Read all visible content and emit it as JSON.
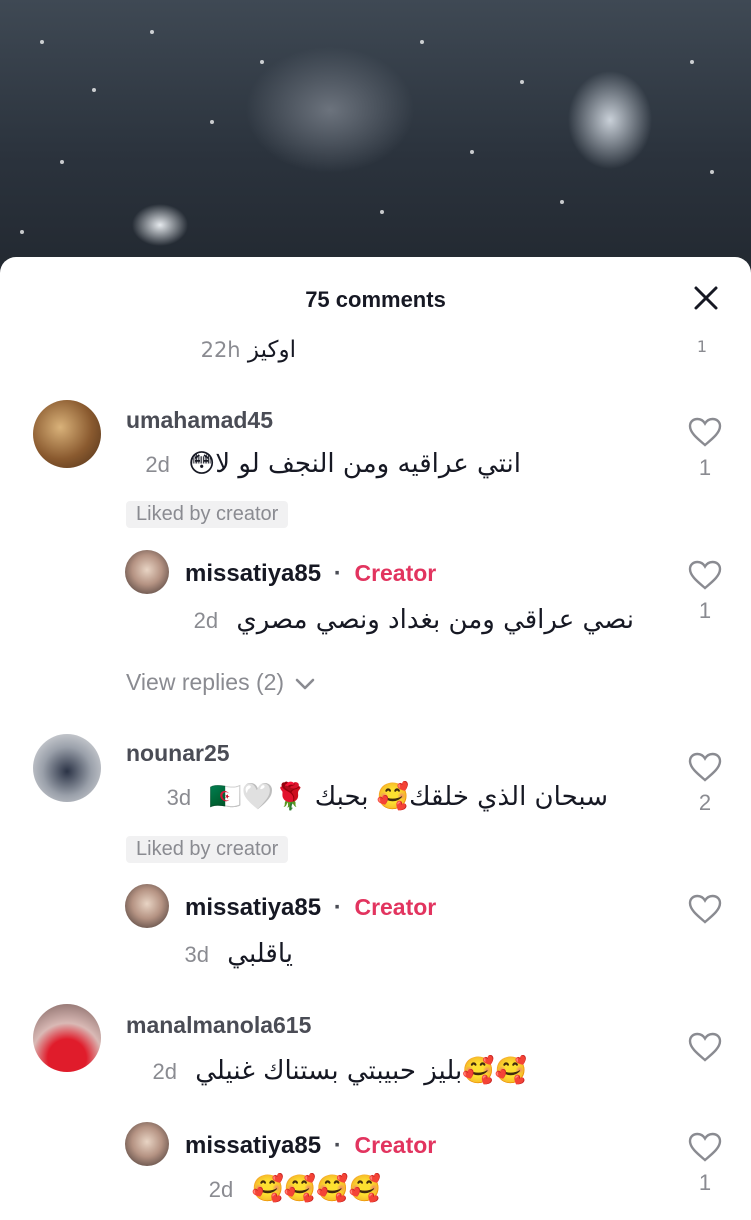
{
  "sheet": {
    "title": "75 comments"
  },
  "previous_reply": {
    "text": "اوكيز",
    "time": "22h",
    "count": "1"
  },
  "comments": [
    {
      "username": "umahamad45",
      "text": "انتي عراقيه ومن النجف لو لا😳",
      "time": "2d",
      "liked_badge": "Liked by creator",
      "likes": "1",
      "reply": {
        "username": "missatiya85",
        "separator": "·",
        "role": "Creator",
        "text": "نصي عراقي ومن بغداد ونصي مصري",
        "time": "2d",
        "likes": "1"
      },
      "view_replies": "View replies (2)"
    },
    {
      "username": "nounar25",
      "text": "سبحان الذي خلقك🥰 بحبك 🌹🤍🇩🇿",
      "time": "3d",
      "liked_badge": "Liked by creator",
      "likes": "2",
      "reply": {
        "username": "missatiya85",
        "separator": "·",
        "role": "Creator",
        "text": "ياقلبي",
        "time": "3d",
        "likes": ""
      }
    },
    {
      "username": "manalmanola615",
      "text": "🥰🥰بليز حبيبتي بستناك غنيلي",
      "time": "2d",
      "likes": "",
      "reply": {
        "username": "missatiya85",
        "separator": "·",
        "role": "Creator",
        "text": "🥰🥰🥰🥰",
        "time": "2d",
        "likes": "1"
      }
    }
  ],
  "icons": {
    "close": "close-icon",
    "heart": "heart-outline-icon",
    "chevron": "chevron-down-icon"
  },
  "colors": {
    "creator": "#e2345f",
    "muted": "#8a8b91",
    "badge_bg": "#f1f1f2"
  }
}
